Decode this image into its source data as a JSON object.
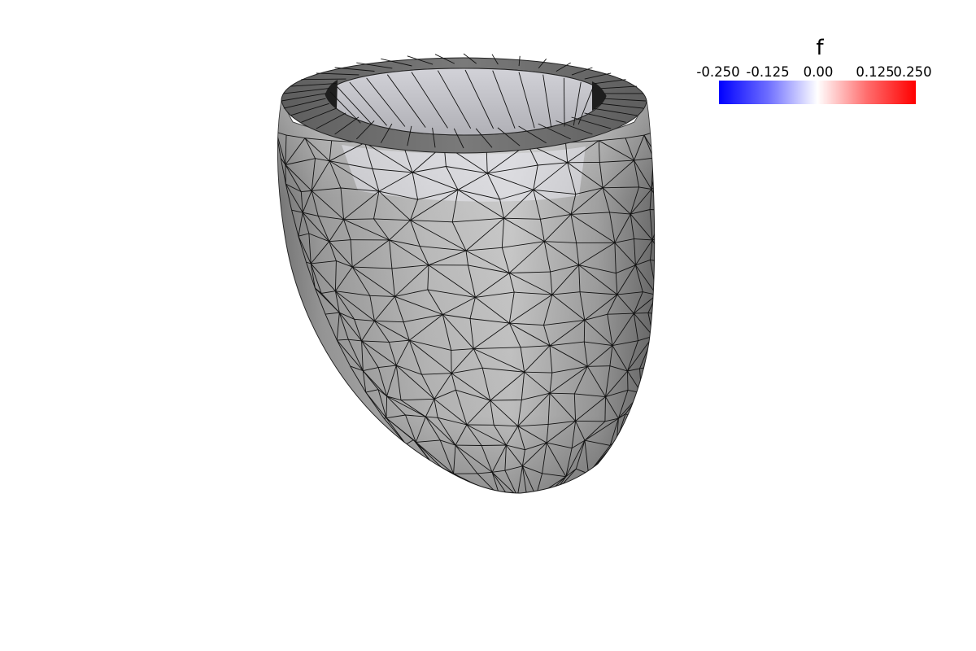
{
  "colorbar": {
    "title": "f",
    "range": [
      -0.25,
      0.25
    ],
    "colors": [
      "#0000ff",
      "#ffffff",
      "#ff0000"
    ],
    "ticks": [
      "-0.250",
      "-0.125",
      "0.00",
      "0.125",
      "0.250"
    ]
  },
  "surface": {
    "shape": "truncated ellipsoid shell (left-ventricle style) tetrahedral mesh",
    "fill": "#b4b4b4",
    "edge_color": "#000000"
  }
}
